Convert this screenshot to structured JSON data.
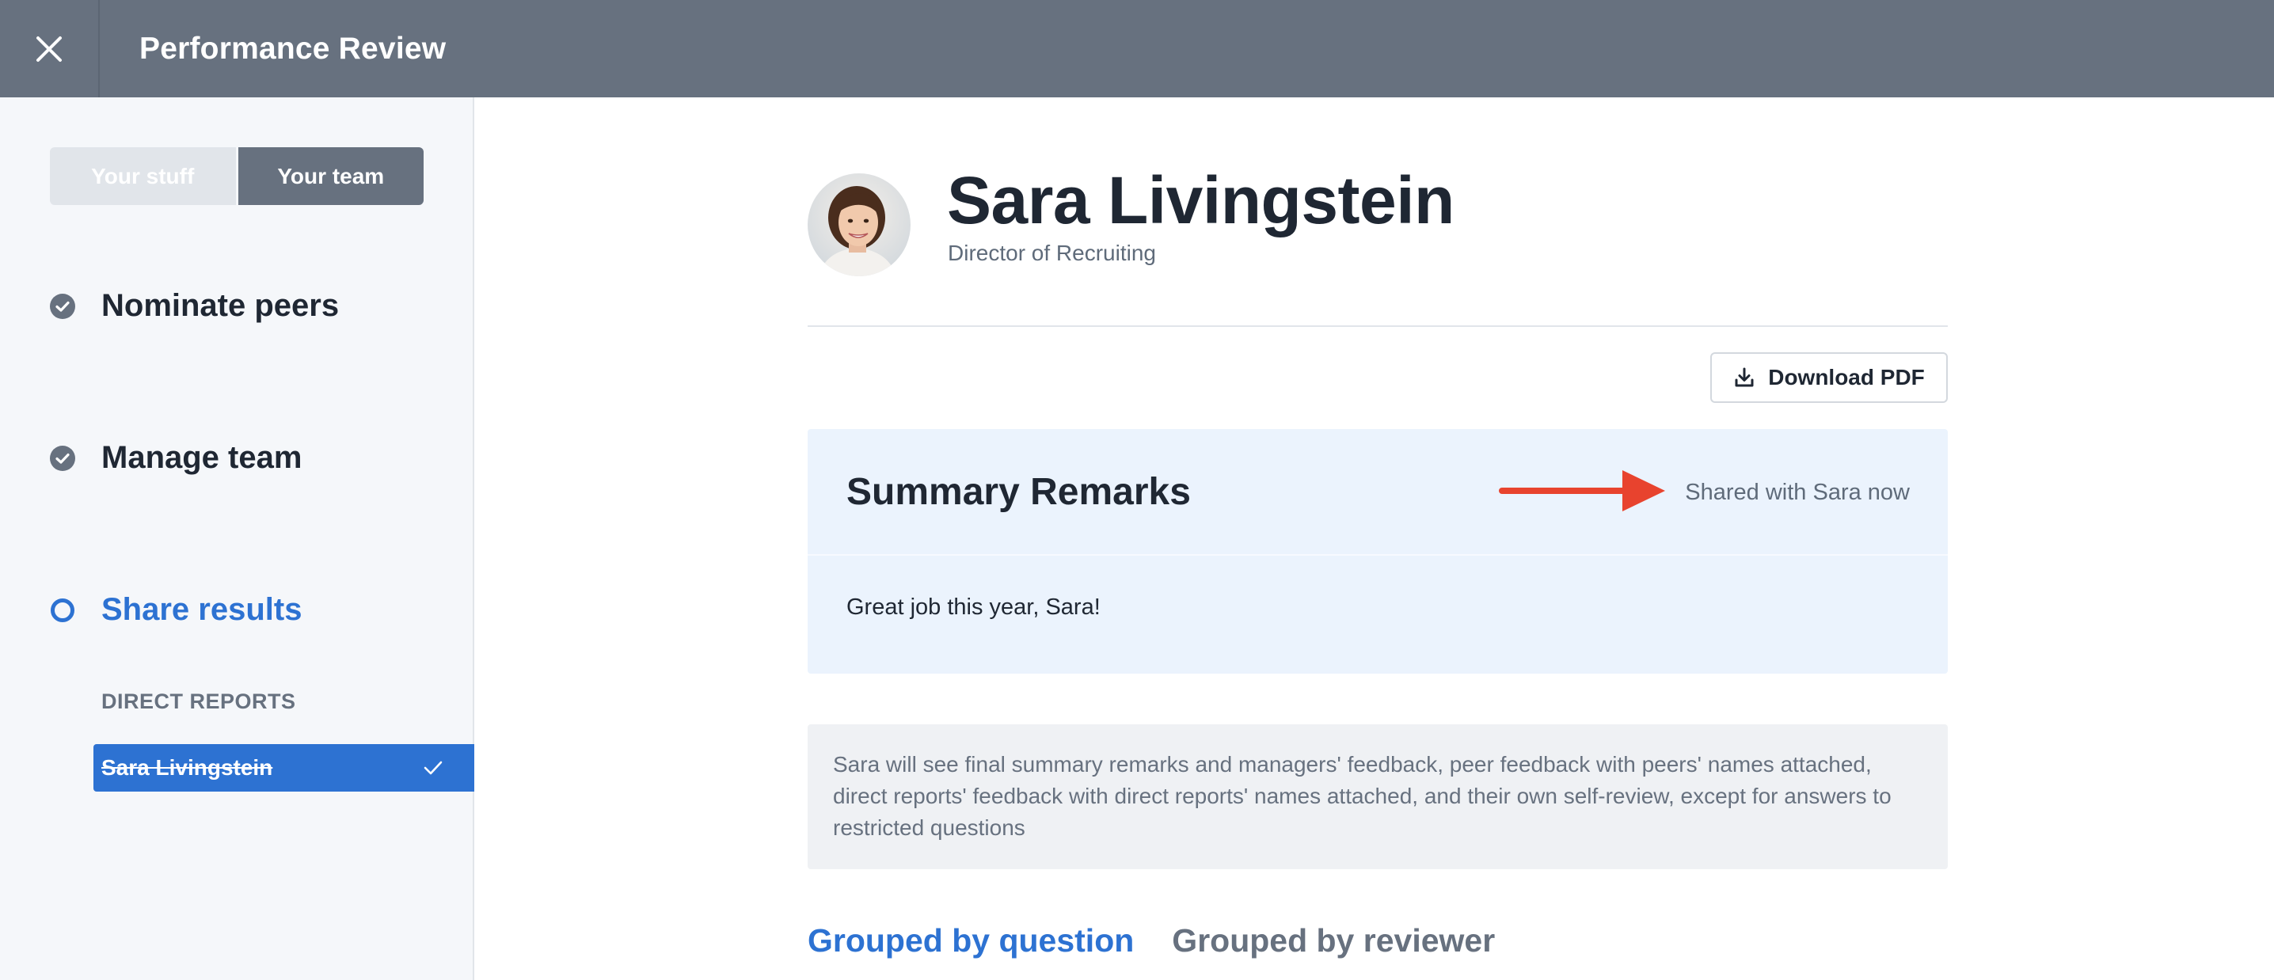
{
  "header": {
    "title": "Performance Review",
    "close_icon": "close-icon"
  },
  "sidebar": {
    "toggle": {
      "options": [
        "Your stuff",
        "Your team"
      ],
      "selected": "Your team"
    },
    "steps": [
      {
        "label": "Nominate peers",
        "status": "complete",
        "icon": "check-circle-icon"
      },
      {
        "label": "Manage team",
        "status": "complete",
        "icon": "check-circle-icon"
      },
      {
        "label": "Share results",
        "status": "current",
        "icon": "ring-icon"
      }
    ],
    "section_label": "DIRECT REPORTS",
    "direct_reports": [
      {
        "name": "Sara Livingstein",
        "done": true,
        "icon": "checkmark-icon"
      }
    ]
  },
  "profile": {
    "name": "Sara Livingstein",
    "title": "Director of Recruiting",
    "avatar_icon": "avatar"
  },
  "actions": {
    "download_label": "Download PDF",
    "download_icon": "download-icon"
  },
  "summary": {
    "title": "Summary Remarks",
    "status": "Shared with Sara now",
    "remark": "Great job this year, Sara!",
    "annotation": "red-arrow-icon"
  },
  "info_note": "Sara will see final summary remarks and managers' feedback, peer feedback with peers' names attached, direct reports' feedback with direct reports' names attached, and their own self-review, except for answers to restricted questions",
  "view_tabs": {
    "items": [
      "Grouped by question",
      "Grouped by reviewer"
    ],
    "selected": "Grouped by question"
  },
  "colors": {
    "header_bg": "#67717f",
    "accent": "#2d72d2",
    "summary_bg": "#ebf3fd",
    "annotation_arrow": "#e8432e"
  }
}
